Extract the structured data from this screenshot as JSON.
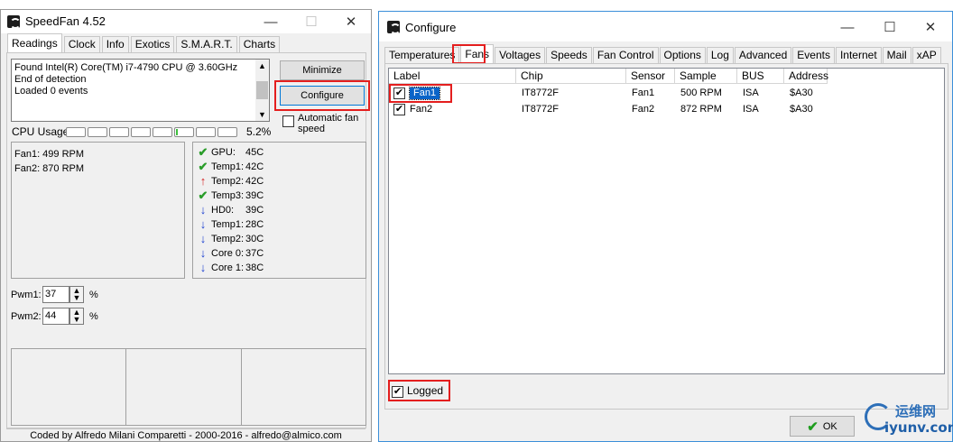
{
  "speedfan": {
    "title": "SpeedFan 4.52",
    "tabs": [
      "Readings",
      "Clock",
      "Info",
      "Exotics",
      "S.M.A.R.T.",
      "Charts"
    ],
    "active_tab": "Readings",
    "log_lines": [
      "Found Intel(R) Core(TM) i7-4790 CPU @ 3.60GHz",
      "End of detection",
      "Loaded 0 events"
    ],
    "minimize_label": "Minimize",
    "configure_label": "Configure",
    "auto_fan_label": "Automatic fan speed",
    "auto_fan_checked": false,
    "cpu_usage_label": "CPU Usage",
    "cpu_usage_value": "5.2%",
    "cpu_core_count": 8,
    "cpu_active_core": 5,
    "fans": [
      "Fan1: 499 RPM",
      "Fan2: 870 RPM"
    ],
    "temps": [
      {
        "name": "GPU:",
        "value": "45C",
        "status": "ok"
      },
      {
        "name": "Temp1:",
        "value": "42C",
        "status": "ok"
      },
      {
        "name": "Temp2:",
        "value": "42C",
        "status": "up"
      },
      {
        "name": "Temp3:",
        "value": "39C",
        "status": "ok"
      },
      {
        "name": "HD0:",
        "value": "39C",
        "status": "down"
      },
      {
        "name": "Temp1:",
        "value": "28C",
        "status": "down"
      },
      {
        "name": "Temp2:",
        "value": "30C",
        "status": "down"
      },
      {
        "name": "Core 0:",
        "value": "37C",
        "status": "down"
      },
      {
        "name": "Core 1:",
        "value": "38C",
        "status": "down"
      }
    ],
    "pwm": [
      {
        "label": "Pwm1:",
        "value": "37",
        "unit": "%"
      },
      {
        "label": "Pwm2:",
        "value": "44",
        "unit": "%"
      }
    ],
    "footer": "Coded by Alfredo Milani Comparetti - 2000-2016 - alfredo@almico.com"
  },
  "configure": {
    "title": "Configure",
    "tabs": [
      "Temperatures",
      "Fans",
      "Voltages",
      "Speeds",
      "Fan Control",
      "Options",
      "Log",
      "Advanced",
      "Events",
      "Internet",
      "Mail",
      "xAP"
    ],
    "active_tab": "Fans",
    "columns": [
      "Label",
      "Chip",
      "Sensor",
      "Sample",
      "BUS",
      "Address"
    ],
    "rows": [
      {
        "checked": true,
        "label": "Fan1",
        "chip": "IT8772F",
        "sensor": "Fan1",
        "sample": "500 RPM",
        "bus": "ISA",
        "address": "$A30"
      },
      {
        "checked": true,
        "label": "Fan2",
        "chip": "IT8772F",
        "sensor": "Fan2",
        "sample": "872 RPM",
        "bus": "ISA",
        "address": "$A30"
      }
    ],
    "logged_label": "Logged",
    "logged_checked": true,
    "ok_label": "OK"
  },
  "watermark": {
    "site": "运维网",
    "url": "iyunv.com"
  },
  "colors": {
    "highlight": "#e41e1e",
    "ok_green": "#2a9d2a",
    "up_red": "#d42020",
    "down_blue": "#1a3fd1",
    "selection": "#0a64c8"
  }
}
